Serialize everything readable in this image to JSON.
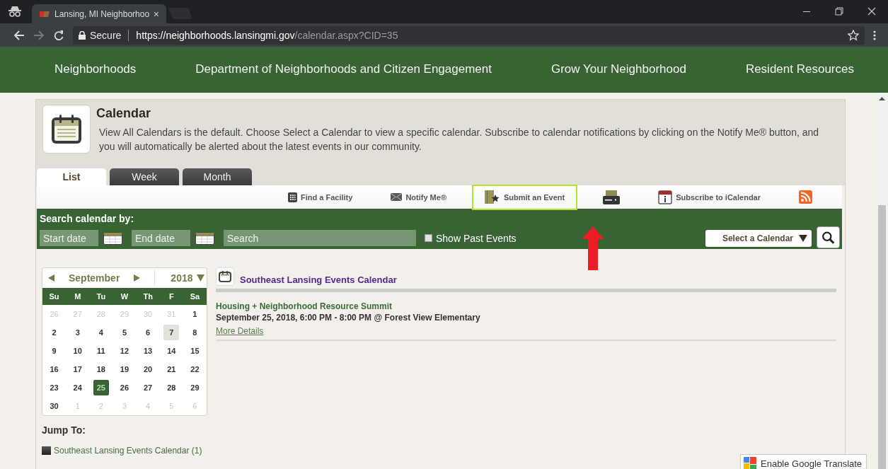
{
  "browser": {
    "tab_title": "Lansing, MI Neighborhoo",
    "tab_close": "×",
    "secure_label": "Secure",
    "url_host": "https://neighborhoods.lansingmi.gov",
    "url_path": "/calendar.aspx?CID=35"
  },
  "nav": [
    {
      "label": "Neighborhoods"
    },
    {
      "label": "Department of Neighborhoods and Citizen Engagement"
    },
    {
      "label": "Grow Your Neighborhood"
    },
    {
      "label": "Resident Resources"
    }
  ],
  "page": {
    "title": "Calendar",
    "description": "View All Calendars is the default. Choose Select a Calendar to view a specific calendar. Subscribe to calendar notifications by clicking on the Notify Me® button, and you will automatically be alerted about the latest events in our community."
  },
  "tabs": [
    {
      "label": "List",
      "selected": true
    },
    {
      "label": "Week",
      "selected": false
    },
    {
      "label": "Month",
      "selected": false
    }
  ],
  "toolbar": [
    {
      "kind": "facility",
      "label": "Find a Facility",
      "highlighted": false
    },
    {
      "kind": "notify",
      "label": "Notify Me®",
      "highlighted": false
    },
    {
      "kind": "submit",
      "label": "Submit an Event",
      "highlighted": true
    },
    {
      "kind": "print",
      "highlighted": false
    },
    {
      "kind": "ical",
      "label": "Subscribe to iCalendar",
      "highlighted": false
    },
    {
      "kind": "rss",
      "highlighted": false
    }
  ],
  "search": {
    "heading": "Search calendar by:",
    "start_placeholder": "Start date",
    "end_placeholder": "End date",
    "search_placeholder": "Search",
    "show_past": {
      "label": "Show Past Events",
      "checked": false
    },
    "select_calendar": "Select a Calendar"
  },
  "mini_calendar": {
    "month": "September",
    "year": "2018",
    "weekdays": [
      "Su",
      "M",
      "Tu",
      "W",
      "Th",
      "F",
      "Sa"
    ],
    "weeks": [
      {
        "days": [
          {
            "day": "26",
            "outside": true,
            "today": false,
            "selected": false
          },
          {
            "day": "27",
            "outside": true,
            "today": false,
            "selected": false
          },
          {
            "day": "28",
            "outside": true,
            "today": false,
            "selected": false
          },
          {
            "day": "29",
            "outside": true,
            "today": false,
            "selected": false
          },
          {
            "day": "30",
            "outside": true,
            "today": false,
            "selected": false
          },
          {
            "day": "31",
            "outside": true,
            "today": false,
            "selected": false
          },
          {
            "day": "1",
            "outside": false,
            "today": false,
            "selected": false
          }
        ]
      },
      {
        "days": [
          {
            "day": "2",
            "outside": false,
            "today": false,
            "selected": false
          },
          {
            "day": "3",
            "outside": false,
            "today": false,
            "selected": false
          },
          {
            "day": "4",
            "outside": false,
            "today": false,
            "selected": false
          },
          {
            "day": "5",
            "outside": false,
            "today": false,
            "selected": false
          },
          {
            "day": "6",
            "outside": false,
            "today": false,
            "selected": false
          },
          {
            "day": "7",
            "outside": false,
            "today": true,
            "selected": false
          },
          {
            "day": "8",
            "outside": false,
            "today": false,
            "selected": false
          }
        ]
      },
      {
        "days": [
          {
            "day": "9",
            "outside": false,
            "today": false,
            "selected": false
          },
          {
            "day": "10",
            "outside": false,
            "today": false,
            "selected": false
          },
          {
            "day": "11",
            "outside": false,
            "today": false,
            "selected": false
          },
          {
            "day": "12",
            "outside": false,
            "today": false,
            "selected": false
          },
          {
            "day": "13",
            "outside": false,
            "today": false,
            "selected": false
          },
          {
            "day": "14",
            "outside": false,
            "today": false,
            "selected": false
          },
          {
            "day": "15",
            "outside": false,
            "today": false,
            "selected": false
          }
        ]
      },
      {
        "days": [
          {
            "day": "16",
            "outside": false,
            "today": false,
            "selected": false
          },
          {
            "day": "17",
            "outside": false,
            "today": false,
            "selected": false
          },
          {
            "day": "18",
            "outside": false,
            "today": false,
            "selected": false
          },
          {
            "day": "19",
            "outside": false,
            "today": false,
            "selected": false
          },
          {
            "day": "20",
            "outside": false,
            "today": false,
            "selected": false
          },
          {
            "day": "21",
            "outside": false,
            "today": false,
            "selected": false
          },
          {
            "day": "22",
            "outside": false,
            "today": false,
            "selected": false
          }
        ]
      },
      {
        "days": [
          {
            "day": "23",
            "outside": false,
            "today": false,
            "selected": false
          },
          {
            "day": "24",
            "outside": false,
            "today": false,
            "selected": false
          },
          {
            "day": "25",
            "outside": false,
            "today": false,
            "selected": true
          },
          {
            "day": "26",
            "outside": false,
            "today": false,
            "selected": false
          },
          {
            "day": "27",
            "outside": false,
            "today": false,
            "selected": false
          },
          {
            "day": "28",
            "outside": false,
            "today": false,
            "selected": false
          },
          {
            "day": "29",
            "outside": false,
            "today": false,
            "selected": false
          }
        ]
      },
      {
        "days": [
          {
            "day": "30",
            "outside": false,
            "today": false,
            "selected": false
          },
          {
            "day": "1",
            "outside": true,
            "today": false,
            "selected": false
          },
          {
            "day": "2",
            "outside": true,
            "today": false,
            "selected": false
          },
          {
            "day": "3",
            "outside": true,
            "today": false,
            "selected": false
          },
          {
            "day": "4",
            "outside": true,
            "today": false,
            "selected": false
          },
          {
            "day": "5",
            "outside": true,
            "today": false,
            "selected": false
          },
          {
            "day": "6",
            "outside": true,
            "today": false,
            "selected": false
          }
        ]
      }
    ]
  },
  "jump_to": {
    "heading": "Jump To:",
    "links": [
      {
        "label": "Southeast Lansing Events Calendar (1)"
      }
    ]
  },
  "calendars": [
    {
      "name": "Southeast Lansing Events Calendar",
      "events": [
        {
          "title": "Housing + Neighborhood Resource Summit",
          "when": "September 25, 2018, 6:00 PM - 8:00 PM @ Forest View Elementary",
          "link": "More Details"
        }
      ]
    }
  ],
  "translate": {
    "label": "Enable Google Translate"
  }
}
